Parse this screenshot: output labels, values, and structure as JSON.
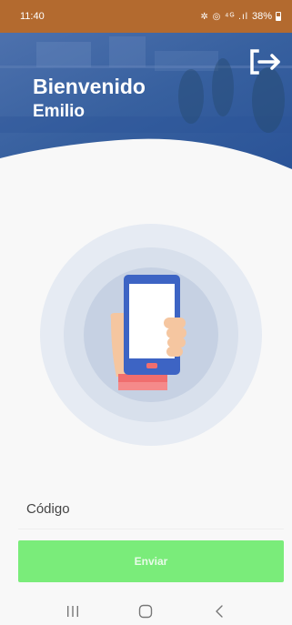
{
  "status_bar": {
    "time": "11:40",
    "icons_text": "✲ ◎ ⁴ᴳ .ıl",
    "battery": "38%"
  },
  "header": {
    "title": "Bienvenido",
    "user_name": "Emilio",
    "logout_icon": "logout-icon"
  },
  "illustration": {
    "icon": "phone-in-hand-icon",
    "colors": {
      "outer_circle": "#e6ebf3",
      "middle_circle": "#d8e0ec",
      "inner_circle": "#c6d1e3",
      "phone": "#3d64c4",
      "screen": "#ffffff",
      "hand": "#f5c6a0",
      "cuff": "#f06e6e"
    }
  },
  "form": {
    "code_placeholder": "Código",
    "code_value": "",
    "send_label": "Enviar"
  },
  "nav": {
    "recents_icon": "recents-icon",
    "home_icon": "home-icon",
    "back_icon": "back-icon"
  },
  "colors": {
    "status_bar": "#b36a2f",
    "header_blue": "#2e5aa8",
    "send_button": "#7aec7a"
  }
}
